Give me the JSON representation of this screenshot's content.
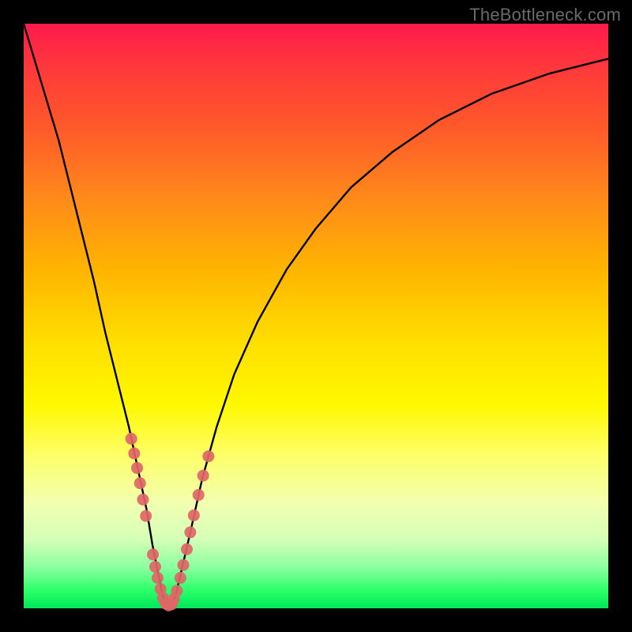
{
  "watermark": "TheBottleneck.com",
  "chart_data": {
    "type": "line",
    "title": "",
    "xlabel": "",
    "ylabel": "",
    "xlim": [
      0,
      100
    ],
    "ylim": [
      0,
      100
    ],
    "grid": false,
    "legend": false,
    "series": [
      {
        "name": "curve",
        "color": "#000000",
        "x": [
          0,
          3,
          6,
          9,
          12,
          14,
          16,
          18,
          19.5,
          21,
          22,
          23,
          23.7,
          24.3,
          25,
          26,
          27,
          28.5,
          30.5,
          33,
          36,
          40,
          45,
          50,
          56,
          63,
          71,
          80,
          90,
          100
        ],
        "y": [
          100,
          90,
          80,
          68,
          56,
          47,
          39,
          31,
          24,
          17,
          11,
          6,
          2.5,
          0.5,
          0.5,
          2.3,
          6.5,
          13,
          22,
          31,
          40,
          49,
          58,
          65,
          72,
          78,
          83.5,
          88,
          91.5,
          94
        ]
      },
      {
        "name": "dots",
        "color": "#e06666",
        "x": [
          18.4,
          18.9,
          19.4,
          19.9,
          20.4,
          20.9,
          22.1,
          22.5,
          22.9,
          23.4,
          23.8,
          24.3,
          24.8,
          25.3,
          25.7,
          26.2,
          26.8,
          27.3,
          27.9,
          28.5,
          29.1,
          29.9,
          30.7,
          31.6
        ],
        "y": [
          29.0,
          26.5,
          24.0,
          21.4,
          18.6,
          15.8,
          9.2,
          7.1,
          5.2,
          3.3,
          1.8,
          0.8,
          0.5,
          0.7,
          1.6,
          3.0,
          5.2,
          7.4,
          10.1,
          13.0,
          15.9,
          19.4,
          22.7,
          26.0
        ]
      }
    ],
    "background_gradient_top": "#ff1a4d",
    "background_gradient_bottom": "#00e85a"
  }
}
